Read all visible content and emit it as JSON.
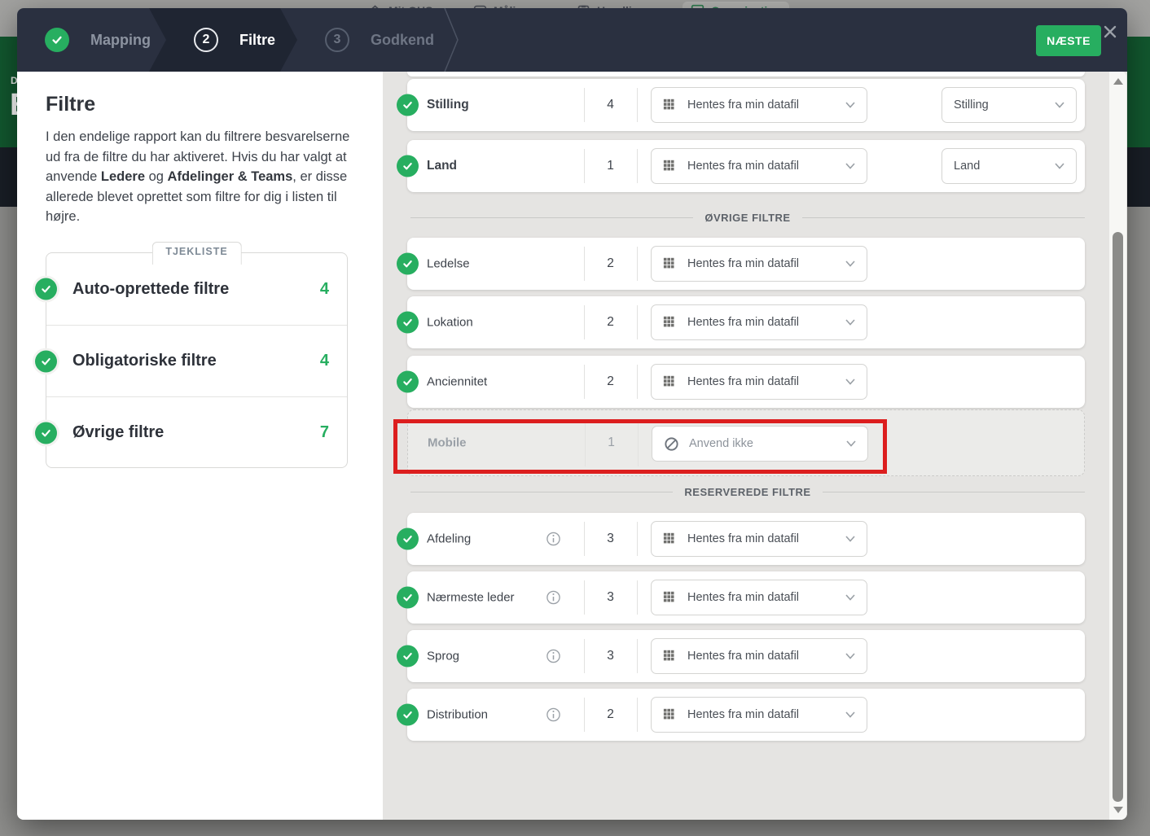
{
  "colors": {
    "accent_green": "#27ae60",
    "highlight_red": "#dc1e1e",
    "header_dark": "#2a3040",
    "banner_green": "#12582f"
  },
  "background": {
    "nav_items": [
      {
        "label": "Mit OHS",
        "icon": "home-icon"
      },
      {
        "label": "Måling",
        "icon": "chat-icon"
      },
      {
        "label": "Handling",
        "icon": "clipboard-icon"
      },
      {
        "label": "Organisation",
        "icon": "org-grid-icon"
      }
    ],
    "banner_line1": "D",
    "banner_line2": "E"
  },
  "wizard": {
    "steps": [
      {
        "label": "Mapping",
        "state": "done"
      },
      {
        "number": "2",
        "label": "Filtre",
        "state": "active"
      },
      {
        "number": "3",
        "label": "Godkend",
        "state": "upcoming"
      }
    ],
    "next_label": "NÆSTE"
  },
  "sidebar": {
    "title": "Filtre",
    "description": {
      "part1": "I den endelige rapport kan du filtrere besvarelserne ud fra de filtre du har aktiveret. Hvis du har valgt at anvende ",
      "bold1": "Ledere",
      "part2": " og ",
      "bold2": "Afdelinger & Teams",
      "part3": ", er disse allerede blevet oprettet som filtre for dig i listen til højre."
    },
    "checklist": {
      "tab_label": "TJEKLISTE",
      "items": [
        {
          "label": "Auto-oprettede filtre",
          "count": "4"
        },
        {
          "label": "Obligatoriske filtre",
          "count": "4"
        },
        {
          "label": "Øvrige filtre",
          "count": "7"
        }
      ]
    }
  },
  "filters": {
    "top_rows": [
      {
        "label": "Stilling",
        "count": "4",
        "source": "Hentes fra min datafil",
        "mapped_to": "Stilling"
      },
      {
        "label": "Land",
        "count": "1",
        "source": "Hentes fra min datafil",
        "mapped_to": "Land"
      }
    ],
    "ovrige": {
      "title": "ØVRIGE FILTRE",
      "rows": [
        {
          "label": "Ledelse",
          "count": "2",
          "source": "Hentes fra min datafil"
        },
        {
          "label": "Lokation",
          "count": "2",
          "source": "Hentes fra min datafil"
        },
        {
          "label": "Anciennitet",
          "count": "2",
          "source": "Hentes fra min datafil"
        },
        {
          "label": "Mobile",
          "count": "1",
          "source": "Anvend ikke",
          "disabled": true,
          "highlighted": true
        }
      ]
    },
    "reserverede": {
      "title": "RESERVEREDE FILTRE",
      "rows": [
        {
          "label": "Afdeling",
          "count": "3",
          "source": "Hentes fra min datafil"
        },
        {
          "label": "Nærmeste leder",
          "count": "3",
          "source": "Hentes fra min datafil"
        },
        {
          "label": "Sprog",
          "count": "3",
          "source": "Hentes fra min datafil"
        },
        {
          "label": "Distribution",
          "count": "2",
          "source": "Hentes fra min datafil"
        }
      ]
    }
  }
}
